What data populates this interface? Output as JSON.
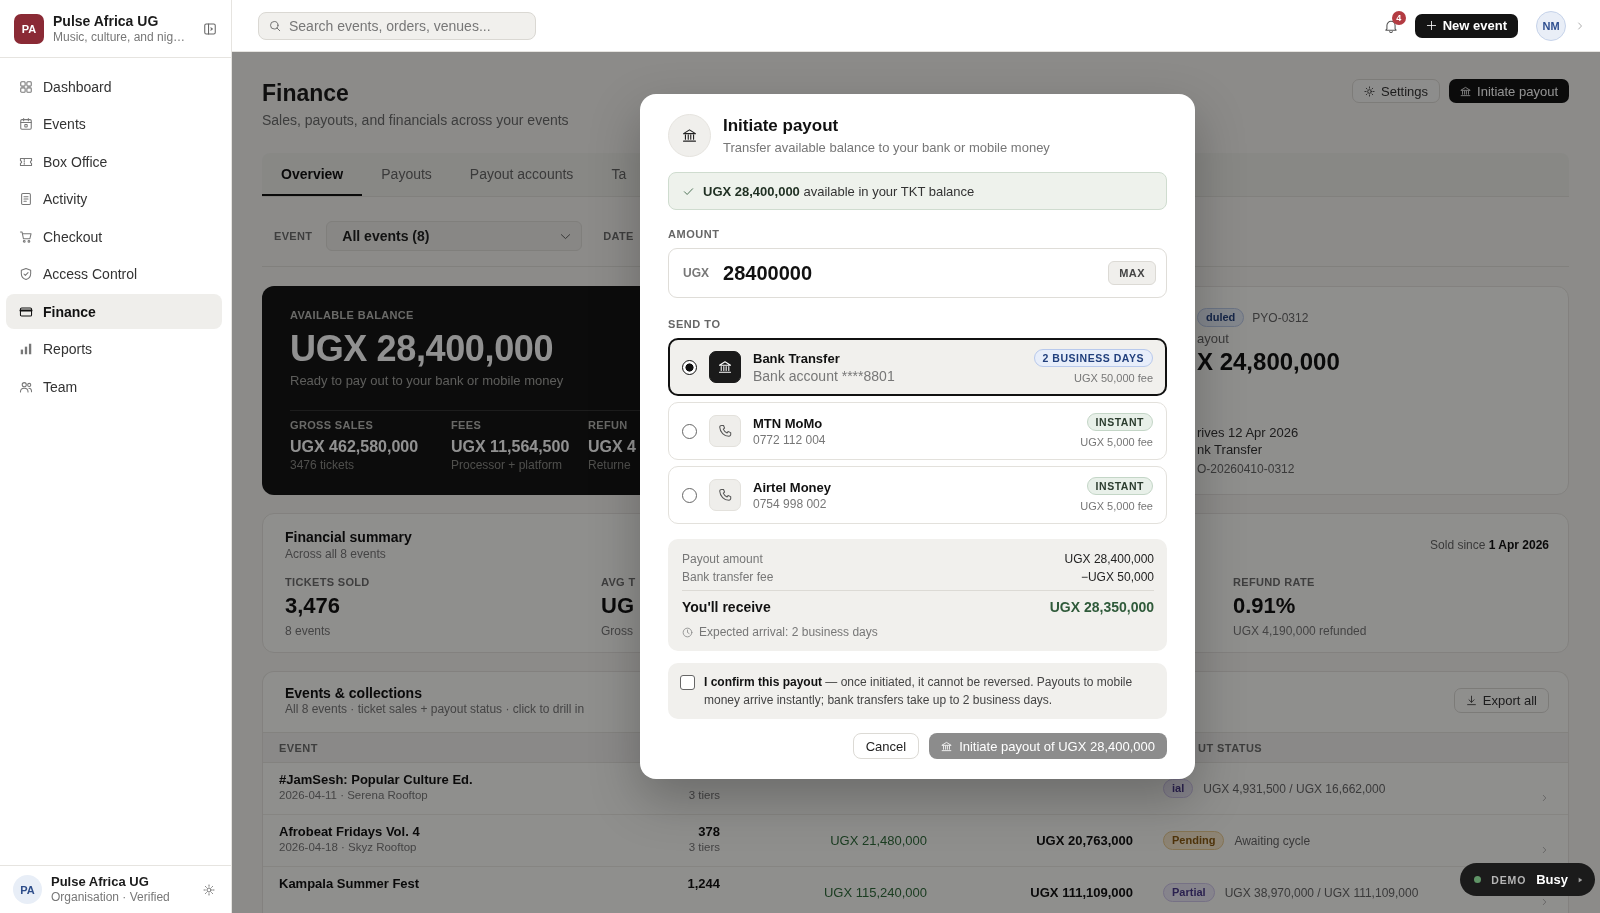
{
  "sidebar": {
    "org": {
      "initials": "PA",
      "name": "Pulse Africa UG",
      "tagline": "Music, culture, and nig…"
    },
    "items": [
      {
        "label": "Dashboard",
        "selected": false
      },
      {
        "label": "Events",
        "selected": false
      },
      {
        "label": "Box Office",
        "selected": false
      },
      {
        "label": "Activity",
        "selected": false
      },
      {
        "label": "Checkout",
        "selected": false
      },
      {
        "label": "Access Control",
        "selected": false
      },
      {
        "label": "Finance",
        "selected": true
      },
      {
        "label": "Reports",
        "selected": false
      },
      {
        "label": "Team",
        "selected": false
      }
    ],
    "account": {
      "initials": "PA",
      "name": "Pulse Africa UG",
      "subtitle": "Organisation · Verified"
    }
  },
  "topbar": {
    "search": {
      "placeholder": "Search events, orders, venues..."
    },
    "notifications": "4",
    "new_event": "New event",
    "avatar": "NM"
  },
  "page": {
    "title": "Finance",
    "subtitle": "Sales, payouts, and financials across your events",
    "actions": [
      {
        "label": "Settings",
        "kind": "settings"
      },
      {
        "label": "Initiate payout",
        "kind": "payout"
      }
    ]
  },
  "tabs": [
    {
      "label": "Overview",
      "selected": true
    },
    {
      "label": "Payouts",
      "selected": false
    },
    {
      "label": "Payout accounts",
      "selected": false
    },
    {
      "label": "Ta",
      "selected": false
    }
  ],
  "filters": {
    "event": {
      "label": "EVENT",
      "value": "All events (8)"
    },
    "date": {
      "label": "DATE"
    }
  },
  "balance_card": {
    "label": "AVAILABLE BALANCE",
    "amount": "UGX 28,400,000",
    "note": "Ready to pay out to your bank or mobile money",
    "stats": [
      {
        "label": "GROSS SALES",
        "value": "UGX 462,580,000",
        "sub": "3476 tickets"
      },
      {
        "label": "FEES",
        "value": "UGX 11,564,500",
        "sub": "Processor + platform"
      },
      {
        "label": "REFUN",
        "value": "UGX 4",
        "sub": "Returne"
      }
    ]
  },
  "payout_card": {
    "status": {
      "label": "duled",
      "kind": "scheduled"
    },
    "reference": "PYO-0312",
    "label": "ayout",
    "amount": "X 24,800,000",
    "details": [
      "rives 12 Apr 2026",
      "nk Transfer"
    ],
    "transaction": "O-20260410-0312"
  },
  "summary": {
    "title": "Financial summary",
    "subtitle": "Across all 8 events",
    "since": "Sold since **1 Apr 2026**",
    "stats": [
      {
        "label": "TICKETS SOLD",
        "value": "3,476",
        "sub": "8 events"
      },
      {
        "label": "AVG T",
        "value": "UG",
        "sub": "Gross"
      },
      {
        "label": "REFUND RATE",
        "value": "0.91%",
        "sub": "UGX 4,190,000 refunded"
      }
    ]
  },
  "events": {
    "title": "Events & collections",
    "subtitle": "All 8 events · ticket sales + payout status · click to drill in",
    "export": "Export all",
    "columns": [
      {
        "label": "EVENT",
        "kind": "event"
      },
      {
        "label": "UT STATUS",
        "kind": "status"
      }
    ],
    "rows": [
      {
        "name": "#JamSesh: Popular Culture Ed.",
        "meta": "2026-04-11 · Serena Rooftop",
        "tiers": "3 tiers",
        "status": {
          "label": "ial",
          "kind": "partial"
        },
        "collected": "UGX 4,931,500 / UGX 16,662,000"
      },
      {
        "name": "Afrobeat Fridays Vol. 4",
        "meta": "2026-04-18 · Skyz Rooftop",
        "tickets": "378",
        "tiers": "3 tiers",
        "gross": "UGX 21,480,000",
        "net": "UGX 20,763,000",
        "status": {
          "label": "Pending",
          "kind": "pending"
        },
        "collected": "Awaiting cycle"
      },
      {
        "name": "Kampala Summer Fest",
        "tickets": "1,244",
        "gross": "UGX 115,240,000",
        "net": "UGX 111,109,000",
        "status": {
          "label": "Partial",
          "kind": "partial"
        },
        "collected": "UGX 38,970,000 / UGX 111,109,000"
      }
    ]
  },
  "dialog": {
    "title": "Initiate payout",
    "subtitle": "Transfer available balance to your bank or mobile money",
    "notice": "**UGX 28,400,000** available in your TKT balance",
    "amount": {
      "label": "AMOUNT",
      "currency": "UGX",
      "value": "28400000",
      "max": "MAX"
    },
    "send_to": {
      "label": "SEND TO",
      "options": [
        {
          "kind": "bank",
          "name": "Bank Transfer",
          "detail": "Bank account ****8801",
          "speed": "2 BUSINESS DAYS",
          "fee": "UGX 50,000 fee",
          "selected": true
        },
        {
          "kind": "mobile",
          "name": "MTN MoMo",
          "detail": "0772 112 004",
          "speed": "INSTANT",
          "fee": "UGX 5,000 fee",
          "selected": false
        },
        {
          "kind": "mobile",
          "name": "Airtel Money",
          "detail": "0754 998 002",
          "speed": "INSTANT",
          "fee": "UGX 5,000 fee",
          "selected": false
        }
      ]
    },
    "breakdown": {
      "lines": [
        {
          "label": "Payout amount",
          "value": "UGX 28,400,000"
        },
        {
          "label": "Bank transfer fee",
          "value": "−UGX 50,000"
        }
      ],
      "total": {
        "label": "You'll receive",
        "value": "UGX 28,350,000"
      },
      "arrival": "Expected arrival: 2 business days"
    },
    "confirm": {
      "text": "**I confirm this payout** — once initiated, it cannot be reversed. Payouts to mobile money arrive instantly; bank transfers take up to 2 business days.",
      "checked": false
    },
    "buttons": [
      {
        "label": "Cancel",
        "kind": "cancel",
        "disabled": false
      },
      {
        "label": "Initiate payout of UGX 28,400,000",
        "kind": "submit",
        "disabled": true
      }
    ]
  },
  "demo": {
    "label": "DEMO",
    "status": "Busy"
  }
}
